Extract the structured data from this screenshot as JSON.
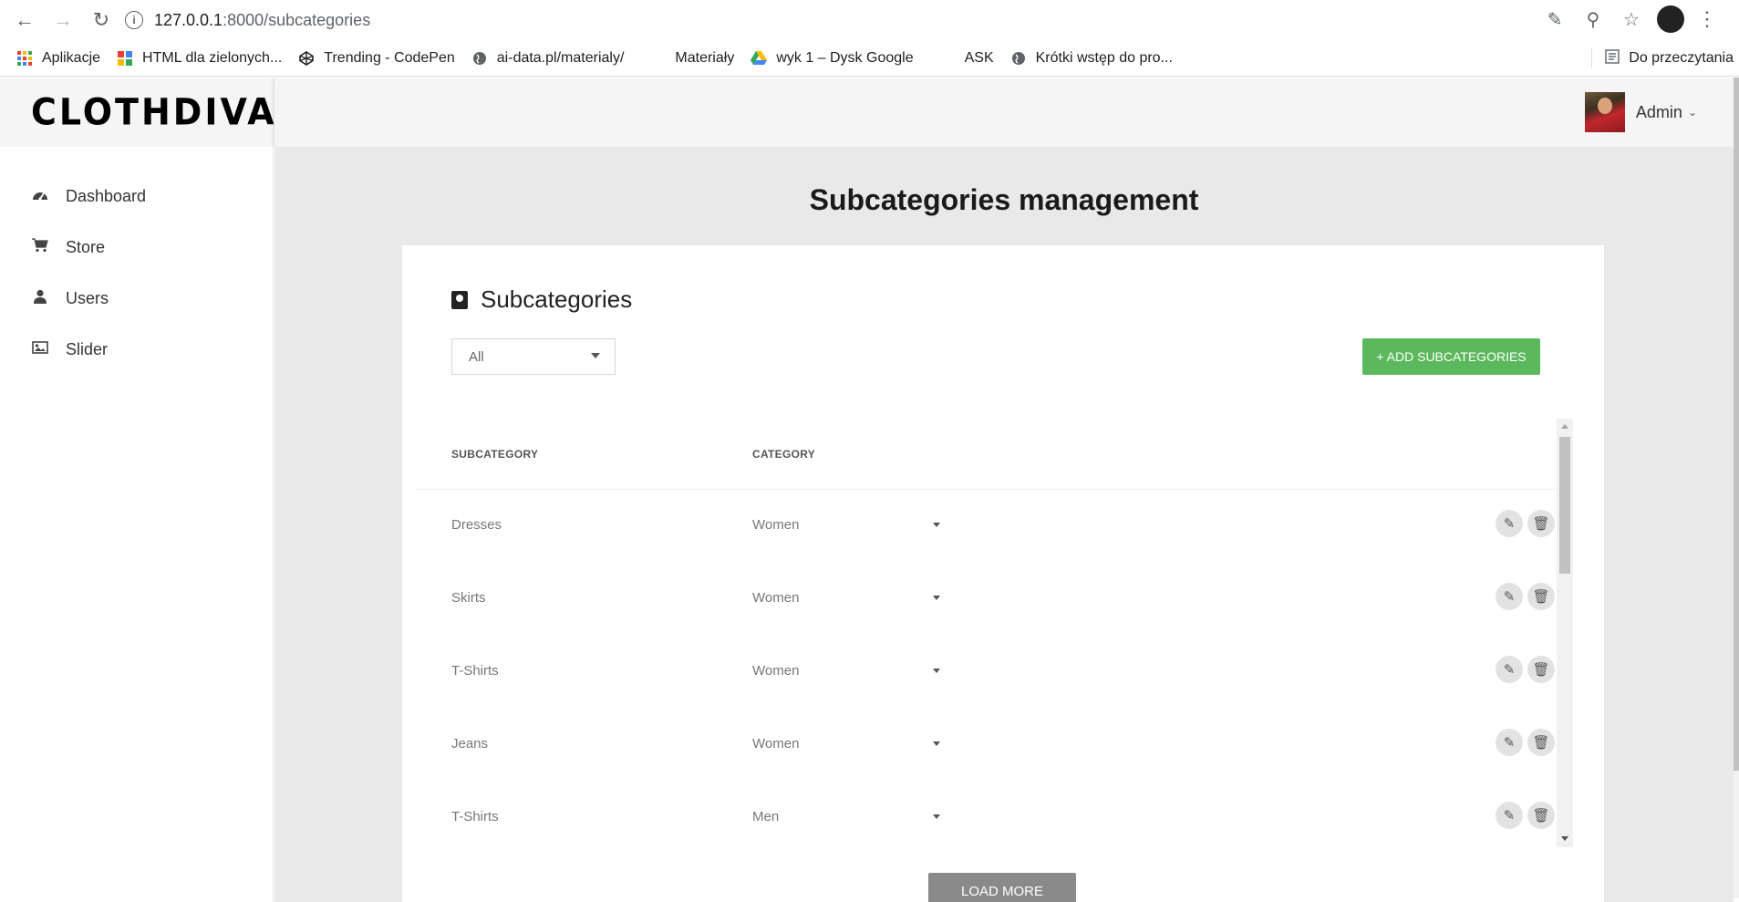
{
  "browser": {
    "url_host": "127.0.0.1",
    "url_rest": ":8000/subcategories",
    "bookmarks": [
      {
        "label": "Aplikacje",
        "icon": "apps-grid-icon"
      },
      {
        "label": "HTML dla zielonych...",
        "icon": "html-site-icon"
      },
      {
        "label": "Trending - CodePen",
        "icon": "codepen-icon"
      },
      {
        "label": "ai-data.pl/materialy/",
        "icon": "globe-icon"
      },
      {
        "label": "Materiały",
        "icon": "blank-icon"
      },
      {
        "label": "wyk 1 – Dysk Google",
        "icon": "google-drive-icon"
      },
      {
        "label": "ASK",
        "icon": "blank-icon"
      },
      {
        "label": "Krótki wstęp do pro...",
        "icon": "globe-icon"
      }
    ],
    "reading_list": "Do przeczytania"
  },
  "app": {
    "logo": "CLOTHDIVA",
    "user": {
      "name": "Admin"
    }
  },
  "sidebar": {
    "items": [
      {
        "label": "Dashboard",
        "icon": "dashboard-icon"
      },
      {
        "label": "Store",
        "icon": "cart-icon"
      },
      {
        "label": "Users",
        "icon": "user-icon"
      },
      {
        "label": "Slider",
        "icon": "image-icon"
      }
    ]
  },
  "main": {
    "title": "Subcategories management",
    "card_title": "Subcategories",
    "filter": {
      "selected": "All"
    },
    "add_button": "+ ADD SUBCATEGORIES",
    "columns": {
      "subcategory": "SUBCATEGORY",
      "category": "CATEGORY"
    },
    "rows": [
      {
        "subcategory": "Dresses",
        "category": "Women"
      },
      {
        "subcategory": "Skirts",
        "category": "Women"
      },
      {
        "subcategory": "T-Shirts",
        "category": "Women"
      },
      {
        "subcategory": "Jeans",
        "category": "Women"
      },
      {
        "subcategory": "T-Shirts",
        "category": "Men"
      }
    ],
    "load_more": "LOAD MORE"
  },
  "colors": {
    "accent_green": "#5cb85c",
    "load_more_gray": "#8a8a8a",
    "main_bg": "#e9e9e9"
  }
}
